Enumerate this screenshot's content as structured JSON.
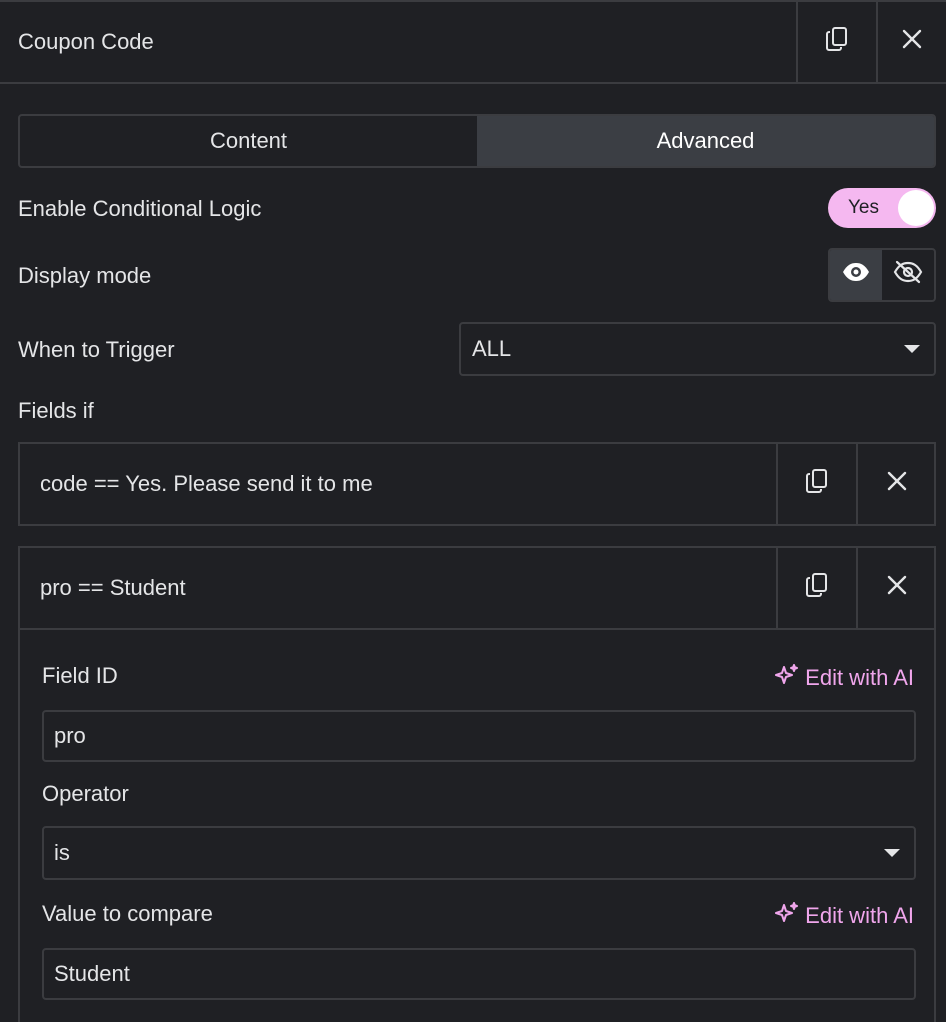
{
  "header": {
    "title": "Coupon Code",
    "icons": {
      "copy": "copy-icon",
      "close": "close-icon"
    }
  },
  "tabs": [
    {
      "label": "Content",
      "active": false
    },
    {
      "label": "Advanced",
      "active": true
    }
  ],
  "conditional": {
    "label": "Enable Conditional Logic",
    "toggle_label": "Yes",
    "enabled": true
  },
  "display_mode": {
    "label": "Display mode",
    "options": [
      "show-icon",
      "hide-icon"
    ],
    "selected": "show-icon"
  },
  "trigger": {
    "label": "When to Trigger",
    "value": "ALL"
  },
  "fields_if": {
    "label": "Fields if"
  },
  "rules": [
    {
      "title": "code == Yes. Please send it to me"
    },
    {
      "title": "pro == Student"
    }
  ],
  "rule_editor": {
    "field_id": {
      "label": "Field ID",
      "ai_label": "Edit with AI",
      "value": "pro"
    },
    "operator": {
      "label": "Operator",
      "value": "is"
    },
    "compare": {
      "label": "Value to compare",
      "ai_label": "Edit with AI",
      "value": "Student"
    }
  },
  "colors": {
    "accent": "#f0a6ec",
    "toggle_bg": "#f5b8f0",
    "panel_bg": "#1f2024",
    "border": "#3b3c40"
  }
}
